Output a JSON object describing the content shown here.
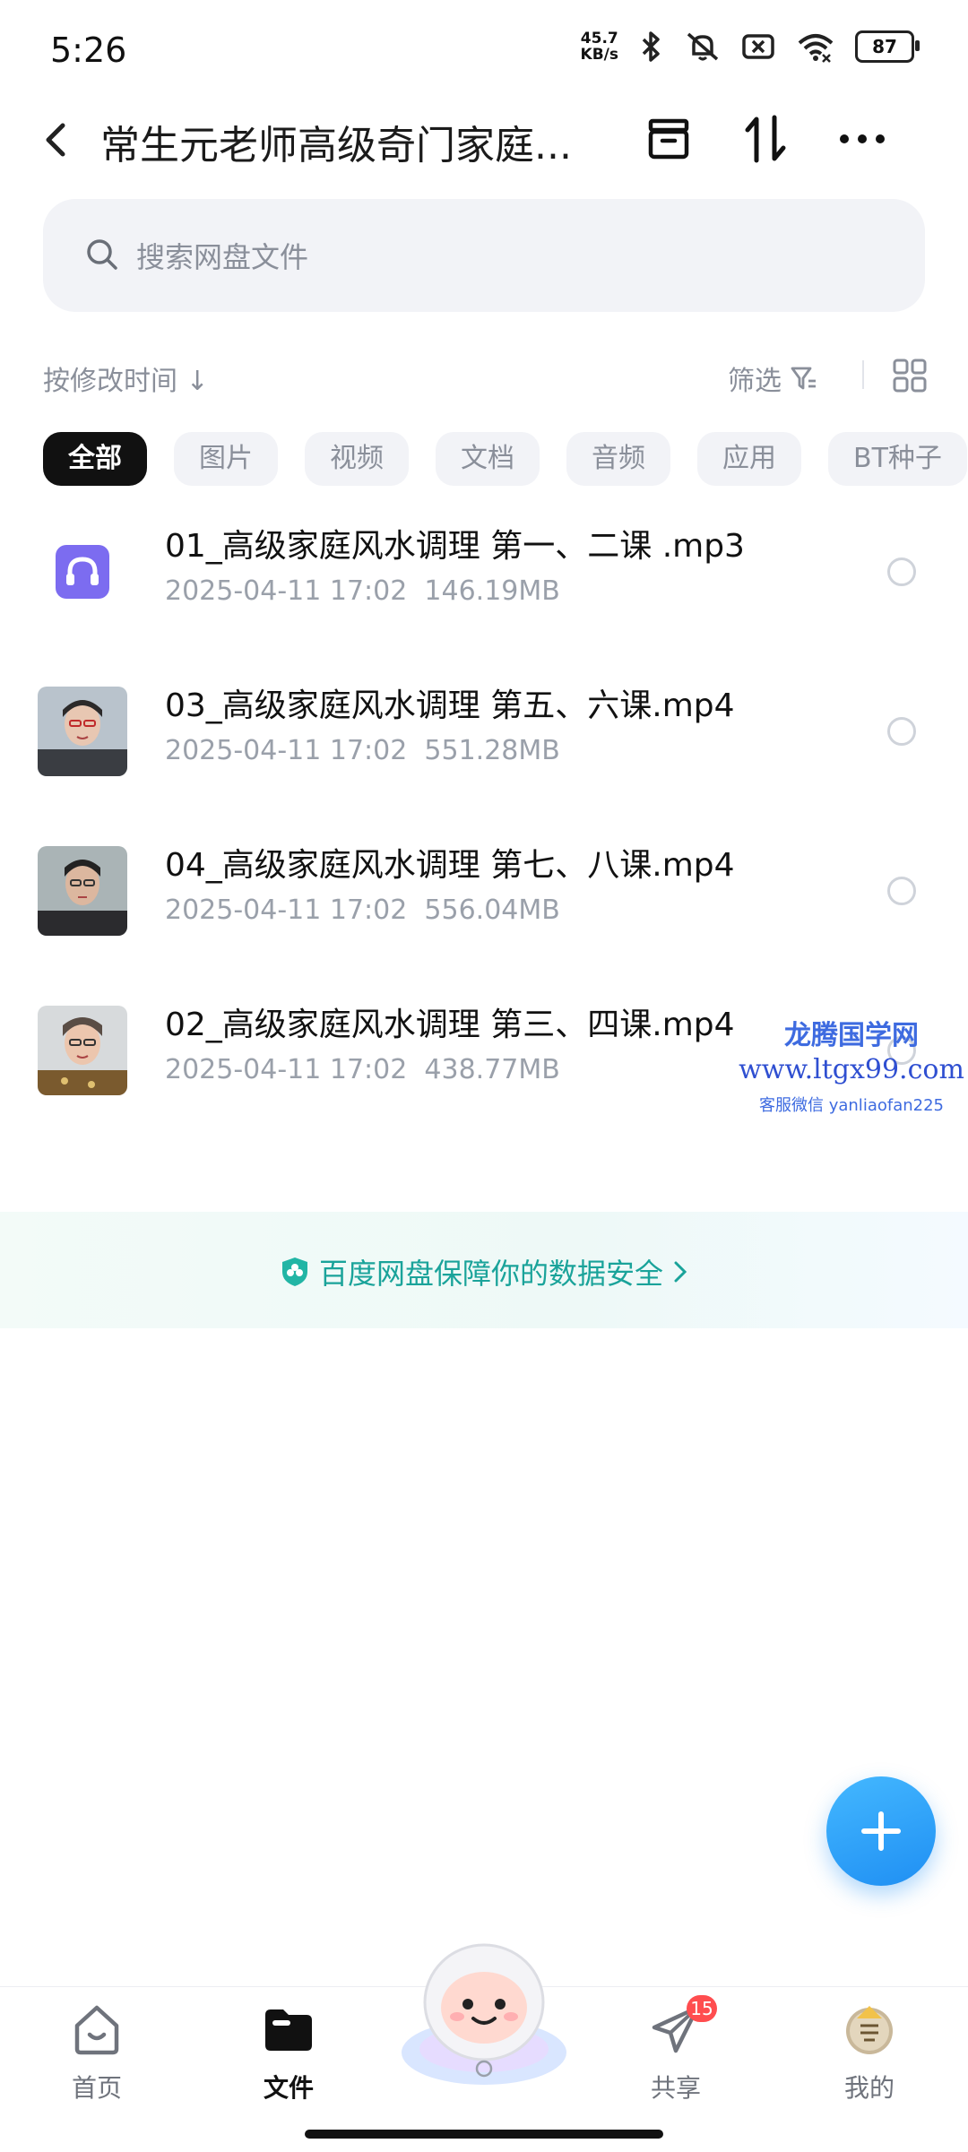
{
  "status_bar": {
    "time": "5:26",
    "net_speed_value": "45.7",
    "net_speed_unit": "KB/s",
    "battery": "87"
  },
  "header": {
    "title": "常生元老师高级奇门家庭...",
    "back_icon": "chevron-left-icon",
    "actions": [
      "archive-icon",
      "sort-arrows-icon",
      "more-icon"
    ]
  },
  "search": {
    "placeholder": "搜索网盘文件"
  },
  "toolbar": {
    "sort_label": "按修改时间 ↓",
    "filter_label": "筛选"
  },
  "chips": [
    {
      "label": "全部",
      "active": true
    },
    {
      "label": "图片"
    },
    {
      "label": "视频"
    },
    {
      "label": "文档"
    },
    {
      "label": "音频"
    },
    {
      "label": "应用"
    },
    {
      "label": "BT种子"
    }
  ],
  "files": [
    {
      "name": "01_高级家庭风水调理 第一、二课 .mp3",
      "date": "2025-04-11  17:02",
      "size": "146.19MB",
      "type": "audio"
    },
    {
      "name": "03_高级家庭风水调理 第五、六课.mp4",
      "date": "2025-04-11  17:02",
      "size": "551.28MB",
      "type": "video"
    },
    {
      "name": "04_高级家庭风水调理 第七、八课.mp4",
      "date": "2025-04-11  17:02",
      "size": "556.04MB",
      "type": "video"
    },
    {
      "name": "02_高级家庭风水调理 第三、四课.mp4",
      "date": "2025-04-11  17:02",
      "size": "438.77MB",
      "type": "video"
    }
  ],
  "watermark": {
    "line1": "龙腾国学网",
    "line2": "www.ltgx99.com",
    "line3": "客服微信 yanliaofan225"
  },
  "security_banner": {
    "text": "百度网盘保障你的数据安全"
  },
  "bottom_nav": {
    "items": [
      {
        "label": "首页",
        "icon": "home-icon"
      },
      {
        "label": "文件",
        "icon": "folder-icon",
        "active": true
      },
      {
        "label": "",
        "icon": "mascot-icon"
      },
      {
        "label": "共享",
        "icon": "share-plane-icon",
        "badge": "15"
      },
      {
        "label": "我的",
        "icon": "avatar-icon"
      }
    ]
  },
  "colors": {
    "accent_blue": "#1f8ff3",
    "security_green": "#1aa39a",
    "audio_icon_purple": "#7c6cf0",
    "badge_red": "#ff4d4f"
  }
}
